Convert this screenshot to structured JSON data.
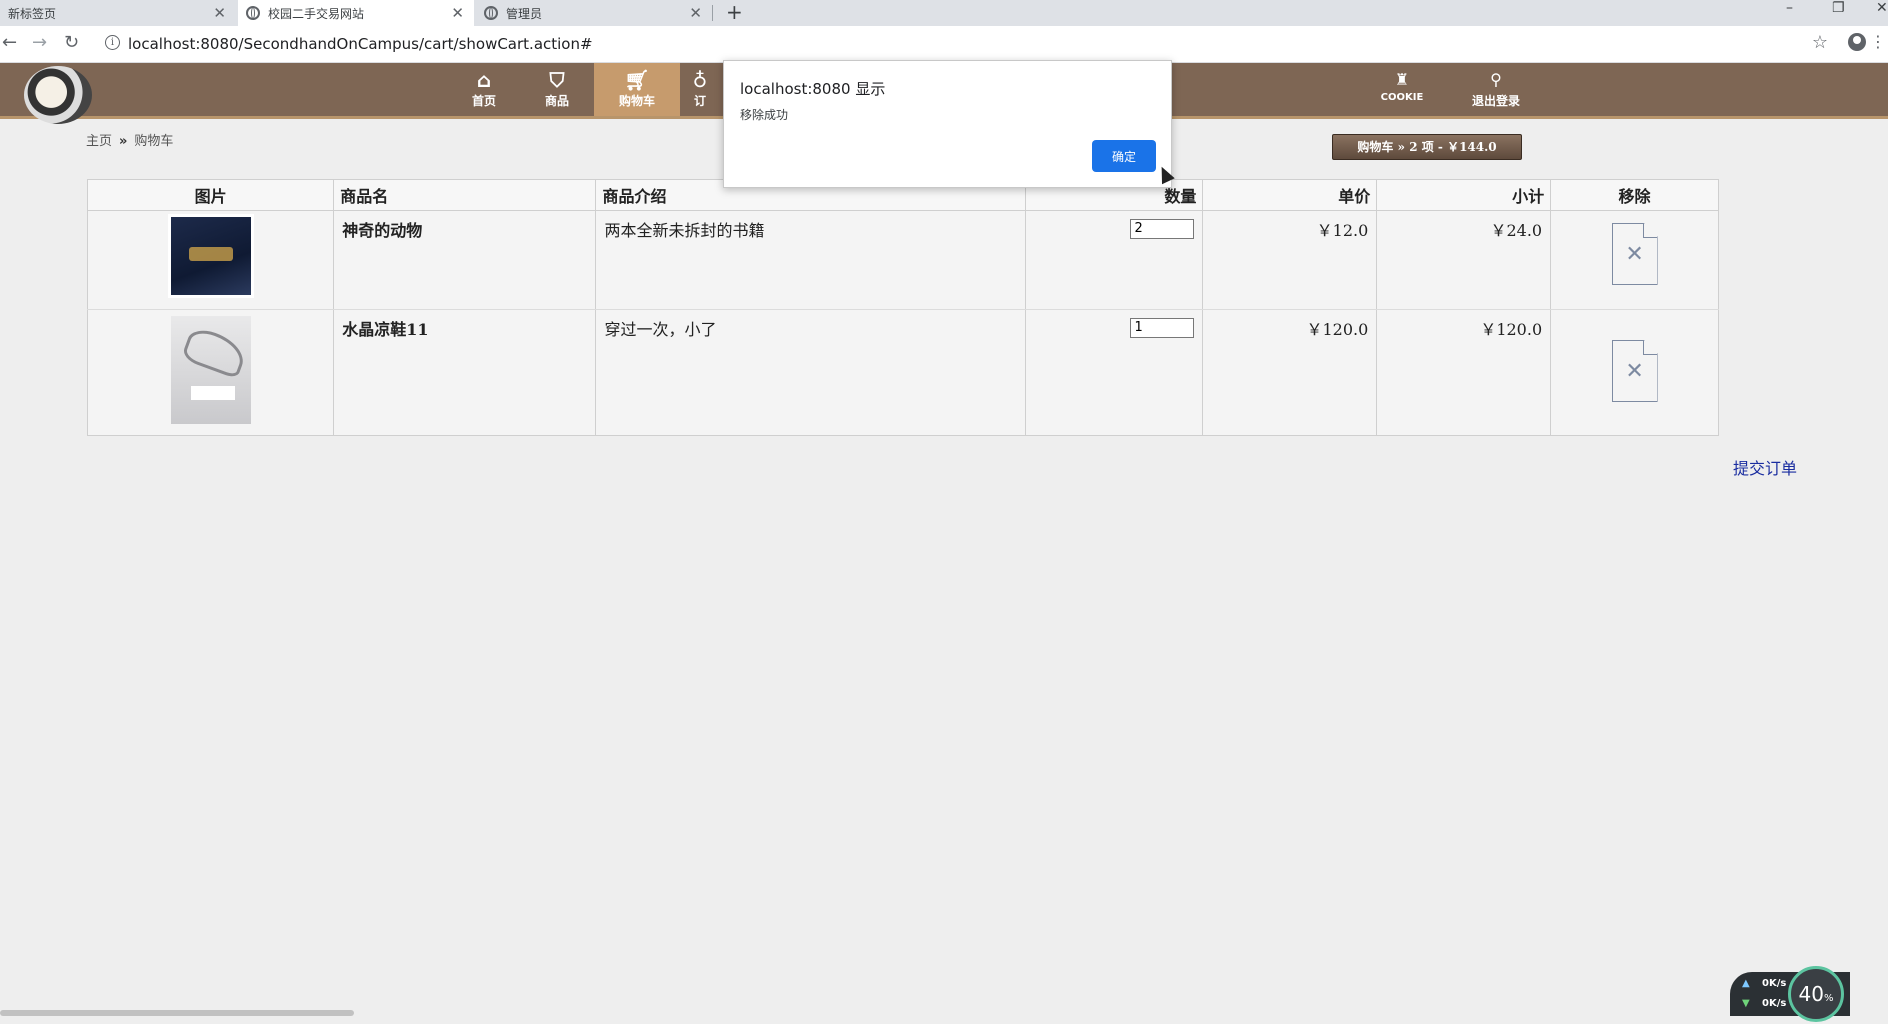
{
  "browser": {
    "tabs": [
      {
        "title": "新标签页",
        "active": false
      },
      {
        "title": "校园二手交易网站",
        "active": true
      },
      {
        "title": "管理员",
        "active": false
      }
    ],
    "url": "localhost:8080/SecondhandOnCampus/cart/showCart.action#"
  },
  "nav": {
    "items": [
      {
        "label": "首页",
        "icon": "home-icon"
      },
      {
        "label": "商品",
        "icon": "basket-icon"
      },
      {
        "label": "购物车",
        "icon": "cart-icon"
      },
      {
        "label": "订",
        "icon": "order-icon"
      }
    ],
    "right_items": [
      {
        "label": "COOKIE",
        "icon": "cookie-icon"
      },
      {
        "label": "退出登录",
        "icon": "logout-icon"
      }
    ]
  },
  "breadcrumb": {
    "home": "主页",
    "separator": "»",
    "current": "购物车"
  },
  "cart_summary": "购物车  » 2 项 - ￥144.0",
  "table": {
    "headers": [
      "图片",
      "商品名",
      "商品介绍",
      "数量",
      "单价",
      "小计",
      "移除"
    ],
    "rows": [
      {
        "name": "神奇的动物",
        "description": "两本全新未拆封的书籍",
        "quantity": "2",
        "price": "￥12.0",
        "subtotal": "￥24.0"
      },
      {
        "name": "水晶凉鞋11",
        "description": "穿过一次，小了",
        "quantity": "1",
        "price": "￥120.0",
        "subtotal": "￥120.0"
      }
    ]
  },
  "submit_order": "提交订单",
  "dialog": {
    "title": "localhost:8080 显示",
    "message": "移除成功",
    "ok_label": "确定"
  },
  "net_monitor": {
    "up": "0K/s",
    "down": "0K/s",
    "percent": "40",
    "percent_unit": "%"
  }
}
